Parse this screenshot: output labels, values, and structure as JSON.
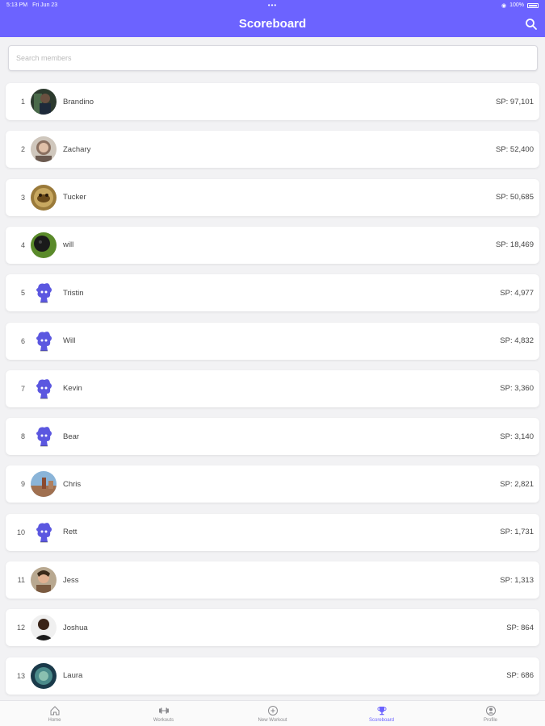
{
  "status": {
    "time": "5:13 PM",
    "date": "Fri Jun 23",
    "dots": "•••",
    "battery": "100%"
  },
  "header": {
    "title": "Scoreboard"
  },
  "search": {
    "placeholder": "Search members"
  },
  "members": [
    {
      "rank": "1",
      "name": "Brandino",
      "score": "SP: 97,101",
      "avatar": "photo-dark"
    },
    {
      "rank": "2",
      "name": "Zachary",
      "score": "SP: 52,400",
      "avatar": "photo-light"
    },
    {
      "rank": "3",
      "name": "Tucker",
      "score": "SP: 50,685",
      "avatar": "photo-gold"
    },
    {
      "rank": "4",
      "name": "will",
      "score": "SP: 18,469",
      "avatar": "photo-green"
    },
    {
      "rank": "5",
      "name": "Tristin",
      "score": "SP: 4,977",
      "avatar": "default"
    },
    {
      "rank": "6",
      "name": "Will",
      "score": "SP: 4,832",
      "avatar": "default"
    },
    {
      "rank": "7",
      "name": "Kevin",
      "score": "SP: 3,360",
      "avatar": "default"
    },
    {
      "rank": "8",
      "name": "Bear",
      "score": "SP: 3,140",
      "avatar": "default"
    },
    {
      "rank": "9",
      "name": "Chris",
      "score": "SP: 2,821",
      "avatar": "photo-landscape"
    },
    {
      "rank": "10",
      "name": "Rett",
      "score": "SP: 1,731",
      "avatar": "default"
    },
    {
      "rank": "11",
      "name": "Jess",
      "score": "SP: 1,313",
      "avatar": "photo-warm"
    },
    {
      "rank": "12",
      "name": "Joshua",
      "score": "SP: 864",
      "avatar": "photo-portrait"
    },
    {
      "rank": "13",
      "name": "Laura",
      "score": "SP: 686",
      "avatar": "photo-teal"
    }
  ],
  "tabs": [
    {
      "label": "Home",
      "icon": "home-icon"
    },
    {
      "label": "Workouts",
      "icon": "dumbbell-icon"
    },
    {
      "label": "New Workout",
      "icon": "plus-circle-icon"
    },
    {
      "label": "Scoreboard",
      "icon": "trophy-icon",
      "active": true
    },
    {
      "label": "Profile",
      "icon": "profile-icon"
    }
  ],
  "colors": {
    "accent": "#6c63ff",
    "tab_inactive": "#8a8a8e"
  }
}
